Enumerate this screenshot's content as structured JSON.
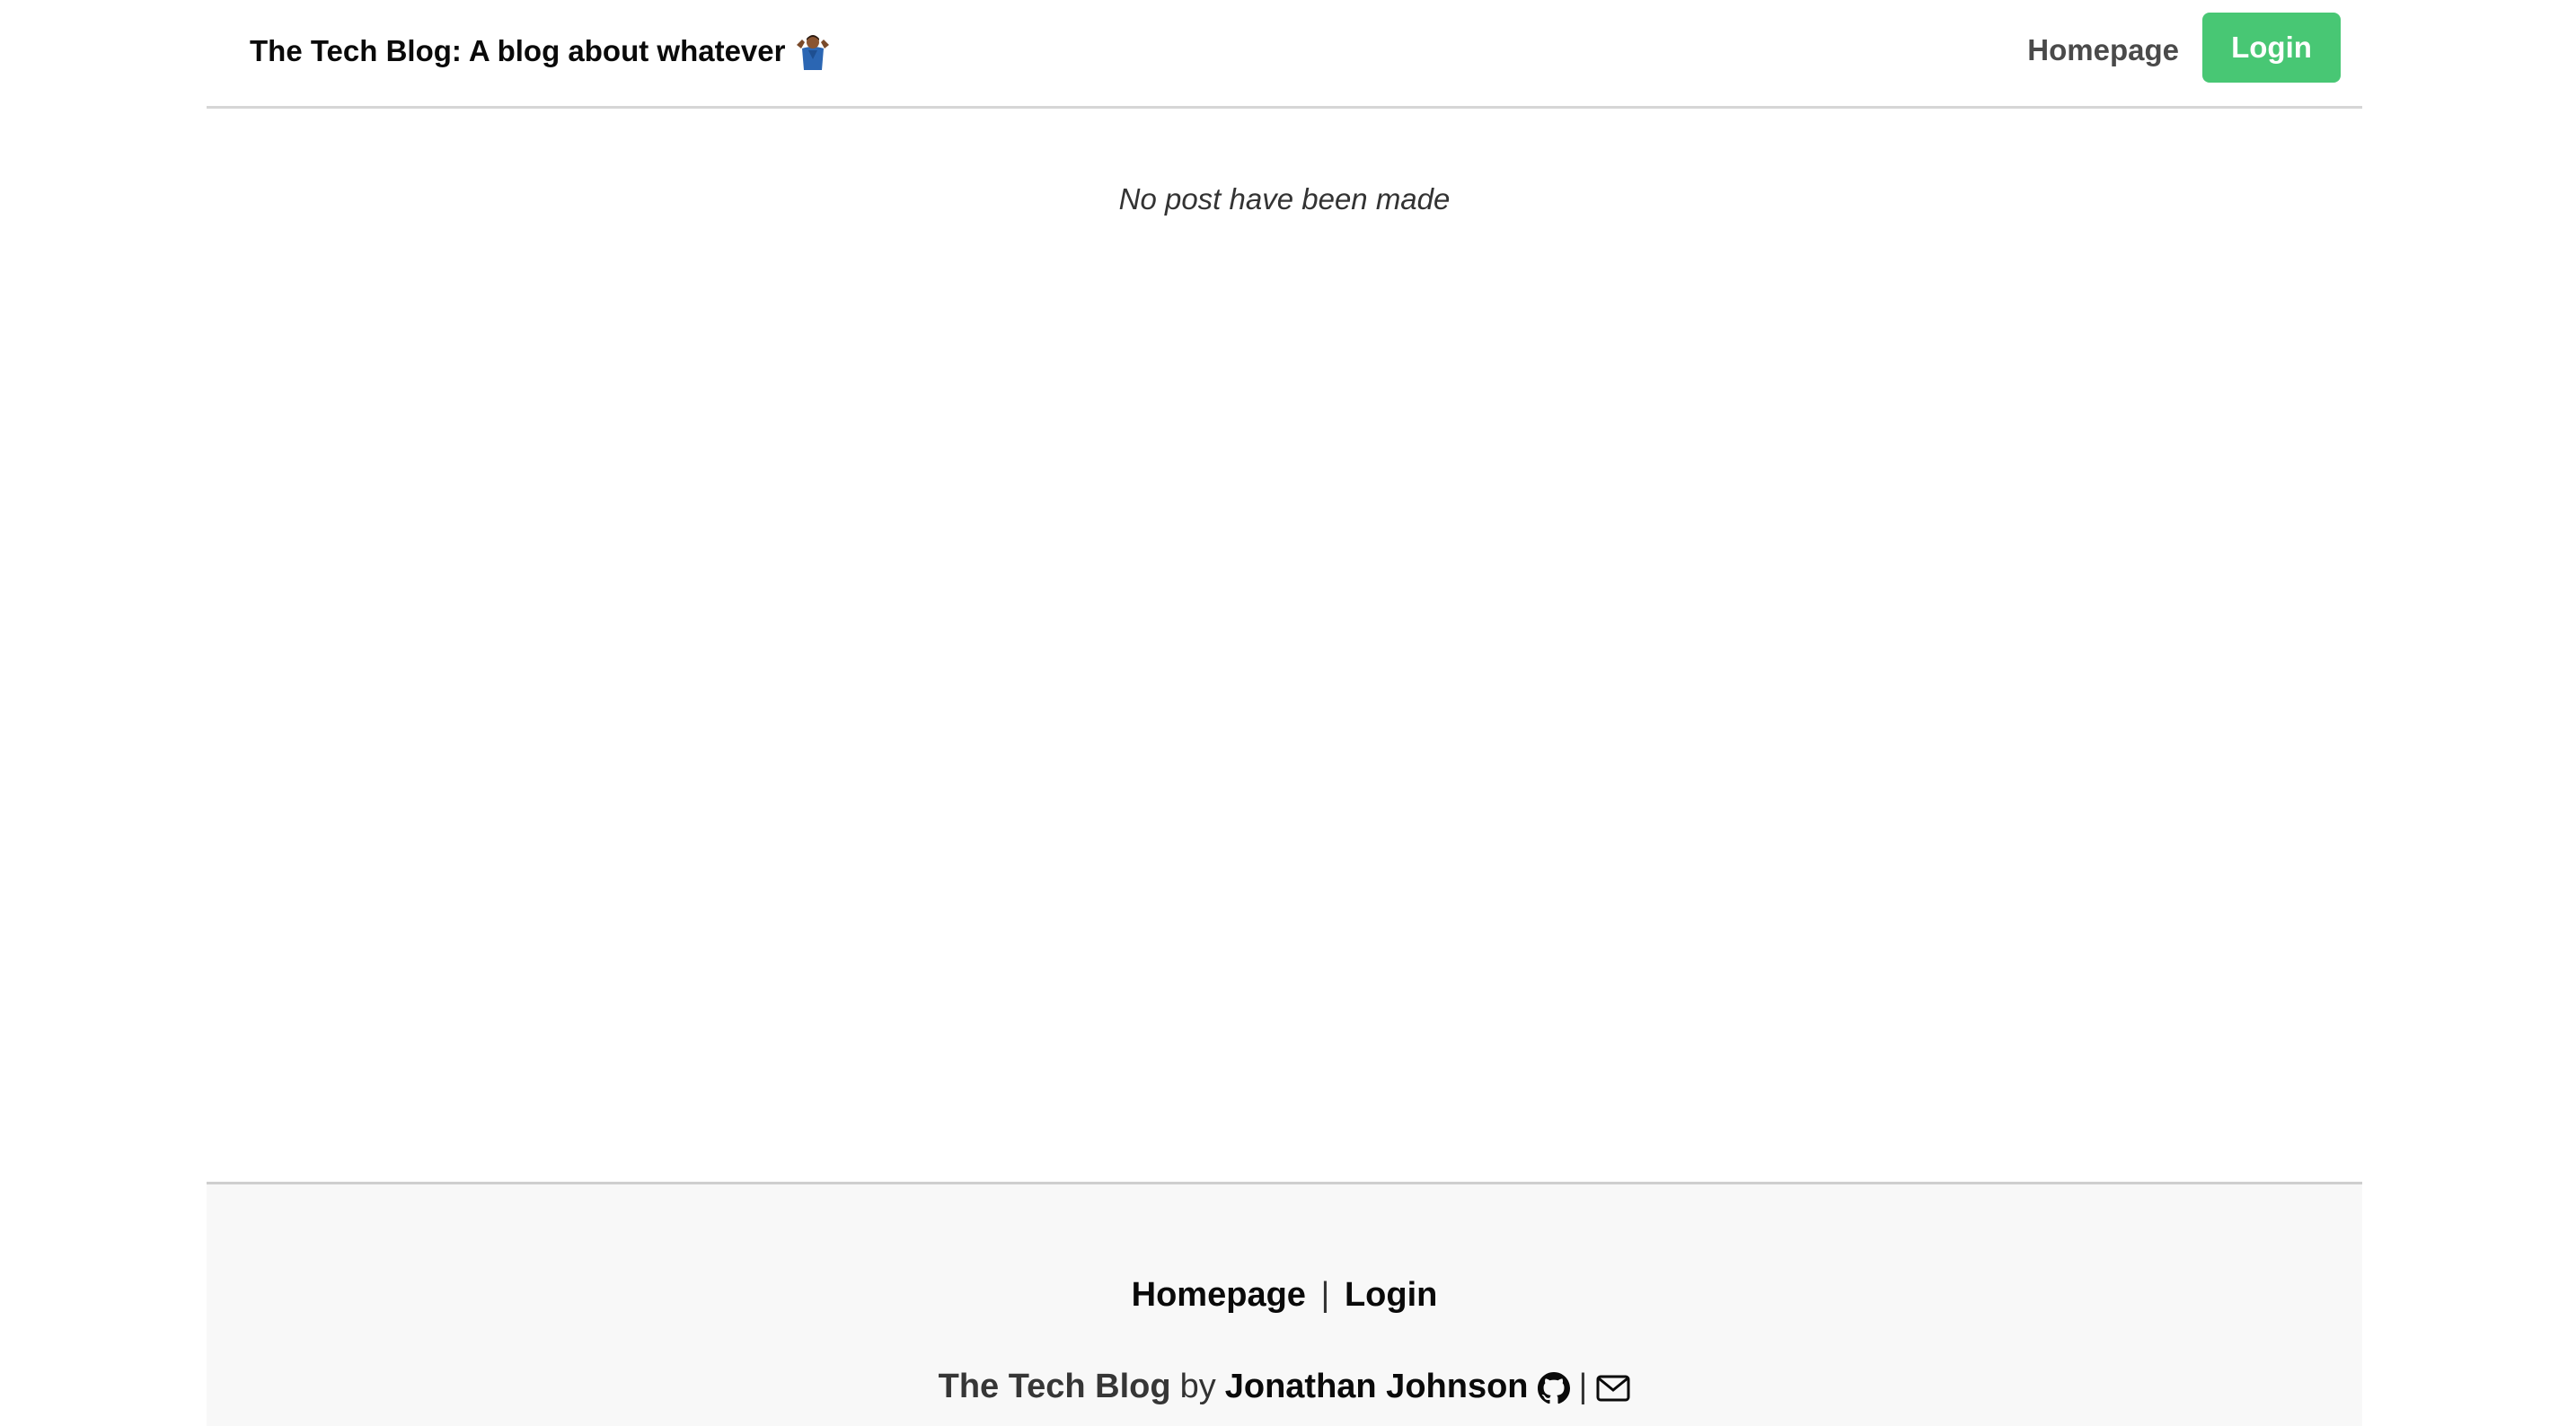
{
  "header": {
    "brand_title": "The Tech Blog: A blog about whatever",
    "brand_emoji_icon": "person-shrugging-icon",
    "nav": {
      "homepage_label": "Homepage",
      "login_label": "Login"
    }
  },
  "main": {
    "empty_message": "No post have been made"
  },
  "footer": {
    "links": {
      "homepage_label": "Homepage",
      "separator": "|",
      "login_label": "Login"
    },
    "credit": {
      "site_name": "The Tech Blog",
      "by": "by",
      "author": "Jonathan Johnson",
      "separator": "|",
      "github_icon": "github-icon",
      "email_icon": "envelope-icon"
    }
  },
  "colors": {
    "login_button": "#48c774",
    "header_border": "#d6d6d6",
    "footer_background": "#f8f8f8"
  }
}
